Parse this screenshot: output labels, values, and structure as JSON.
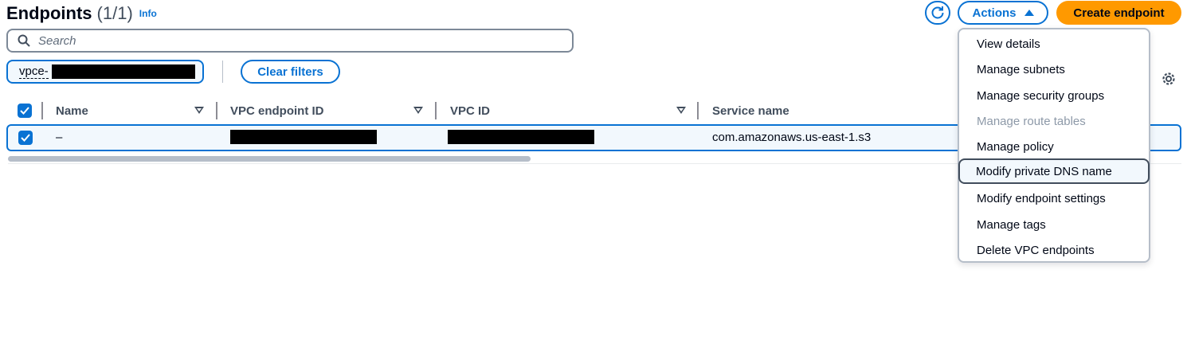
{
  "header": {
    "title": "Endpoints",
    "count": "(1/1)",
    "info": "Info",
    "actions_label": "Actions",
    "create_label": "Create endpoint"
  },
  "search": {
    "placeholder": "Search"
  },
  "filter": {
    "token_prefix": "vpce-",
    "clear_label": "Clear filters"
  },
  "table": {
    "columns": [
      "Name",
      "VPC endpoint ID",
      "VPC ID",
      "Service name"
    ],
    "rows": [
      {
        "name": "–",
        "service_name": "com.amazonaws.us-east-1.s3"
      }
    ]
  },
  "actions_menu": {
    "items": [
      "View details",
      "Manage subnets",
      "Manage security groups",
      "Manage route tables",
      "Manage policy",
      "Modify private DNS name",
      "Modify endpoint settings",
      "Manage tags",
      "Delete VPC endpoints"
    ],
    "disabled_item": "Manage route tables",
    "hovered_item": "Modify private DNS name"
  },
  "colors": {
    "accent": "#0972d3",
    "primary_button": "#ff9900",
    "text": "#000716",
    "selected_row_bg": "#f2f8fd"
  },
  "icons": [
    "refresh-icon",
    "caret-up-icon",
    "search-icon",
    "settings-gear-icon",
    "checkbox-checked-icon",
    "sort-caret-icon"
  ]
}
